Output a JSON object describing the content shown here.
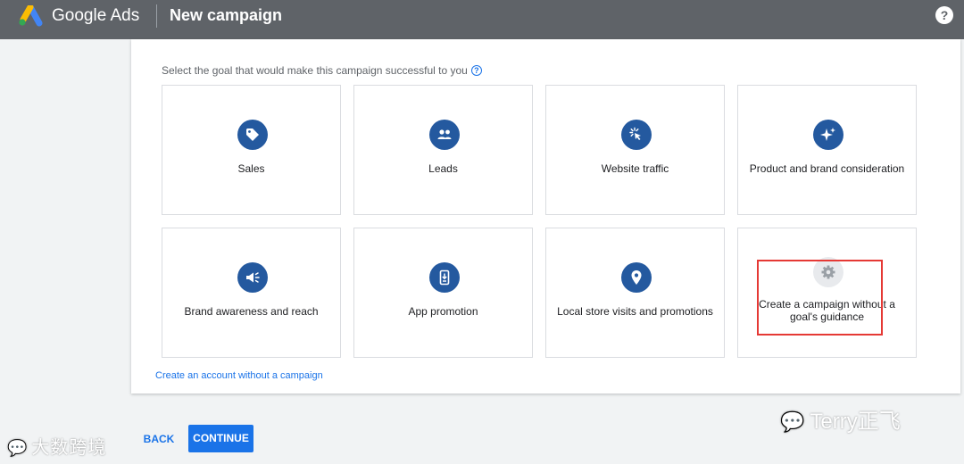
{
  "header": {
    "brand": "Google Ads",
    "title": "New campaign",
    "help_icon": "help-circle-icon",
    "help_symbol": "?"
  },
  "prompt": {
    "text": "Select the goal that would make this campaign successful to you",
    "info_icon": "help-outline-icon",
    "info_symbol": "?"
  },
  "goals": [
    {
      "label": "Sales",
      "icon": "tag-icon"
    },
    {
      "label": "Leads",
      "icon": "people-icon"
    },
    {
      "label": "Website traffic",
      "icon": "cursor-click-icon"
    },
    {
      "label": "Product and brand consideration",
      "icon": "sparkle-icon"
    },
    {
      "label": "Brand awareness and reach",
      "icon": "megaphone-icon"
    },
    {
      "label": "App promotion",
      "icon": "phone-download-icon"
    },
    {
      "label": "Local store visits and promotions",
      "icon": "location-pin-icon"
    },
    {
      "label": "Create a campaign without a goal's guidance",
      "icon": "gear-icon"
    }
  ],
  "links": {
    "no_campaign": "Create an account without a campaign"
  },
  "actions": {
    "back": "BACK",
    "continue": "CONTINUE"
  },
  "watermarks": {
    "left": "大数跨境",
    "right": "Terry正飞"
  },
  "colors": {
    "header_bg": "#5f6368",
    "icon_bg": "#24599f",
    "primary": "#1a73e8",
    "highlight": "#e53935"
  }
}
